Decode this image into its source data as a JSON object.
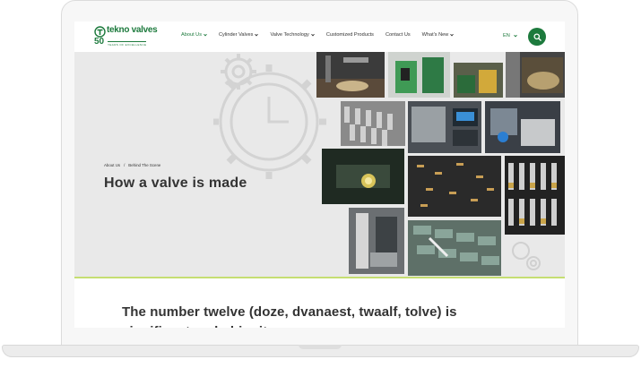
{
  "brand": {
    "name": "tekno valves",
    "anniversary": "50",
    "tagline": "YEARS OF EXCELLENCE",
    "accent_color": "#1d7a3d",
    "highlight_color": "#c5de72"
  },
  "nav": {
    "items": [
      {
        "label": "About Us",
        "dropdown": true,
        "active": true
      },
      {
        "label": "Cylinder Valves",
        "dropdown": true,
        "active": false
      },
      {
        "label": "Valve Technology",
        "dropdown": true,
        "active": false
      },
      {
        "label": "Customized Products",
        "dropdown": false,
        "active": false
      },
      {
        "label": "Contact Us",
        "dropdown": false,
        "active": false
      },
      {
        "label": "What's New",
        "dropdown": true,
        "active": false
      }
    ],
    "language": "EN",
    "search_icon": "search-icon"
  },
  "hero": {
    "breadcrumb": [
      "About Us",
      "/",
      "Behind The Scene"
    ],
    "title": "How a valve is made"
  },
  "content": {
    "heading": "The number twelve (doze, dvanaest, twaalf, tolve) is significant and ubiquitous"
  }
}
